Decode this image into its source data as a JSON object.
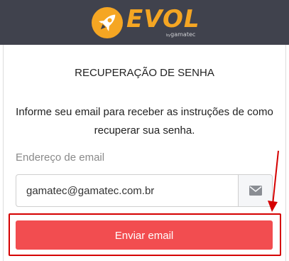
{
  "brand": {
    "name": "EVOL",
    "by": "by",
    "company": "gamatec",
    "accent_color": "#f5a623",
    "header_color": "#40424d"
  },
  "form": {
    "title": "RECUPERAÇÃO DE SENHA",
    "instructions": "Informe seu email para receber as instruções de como recuperar sua senha.",
    "email_label": "Endereço de email",
    "email_value": "gamatec@gamatec.com.br",
    "email_icon": "envelope-icon",
    "submit_label": "Enviar email",
    "submit_color": "#f24d50"
  },
  "annotation": {
    "highlight_color": "#d50000"
  }
}
